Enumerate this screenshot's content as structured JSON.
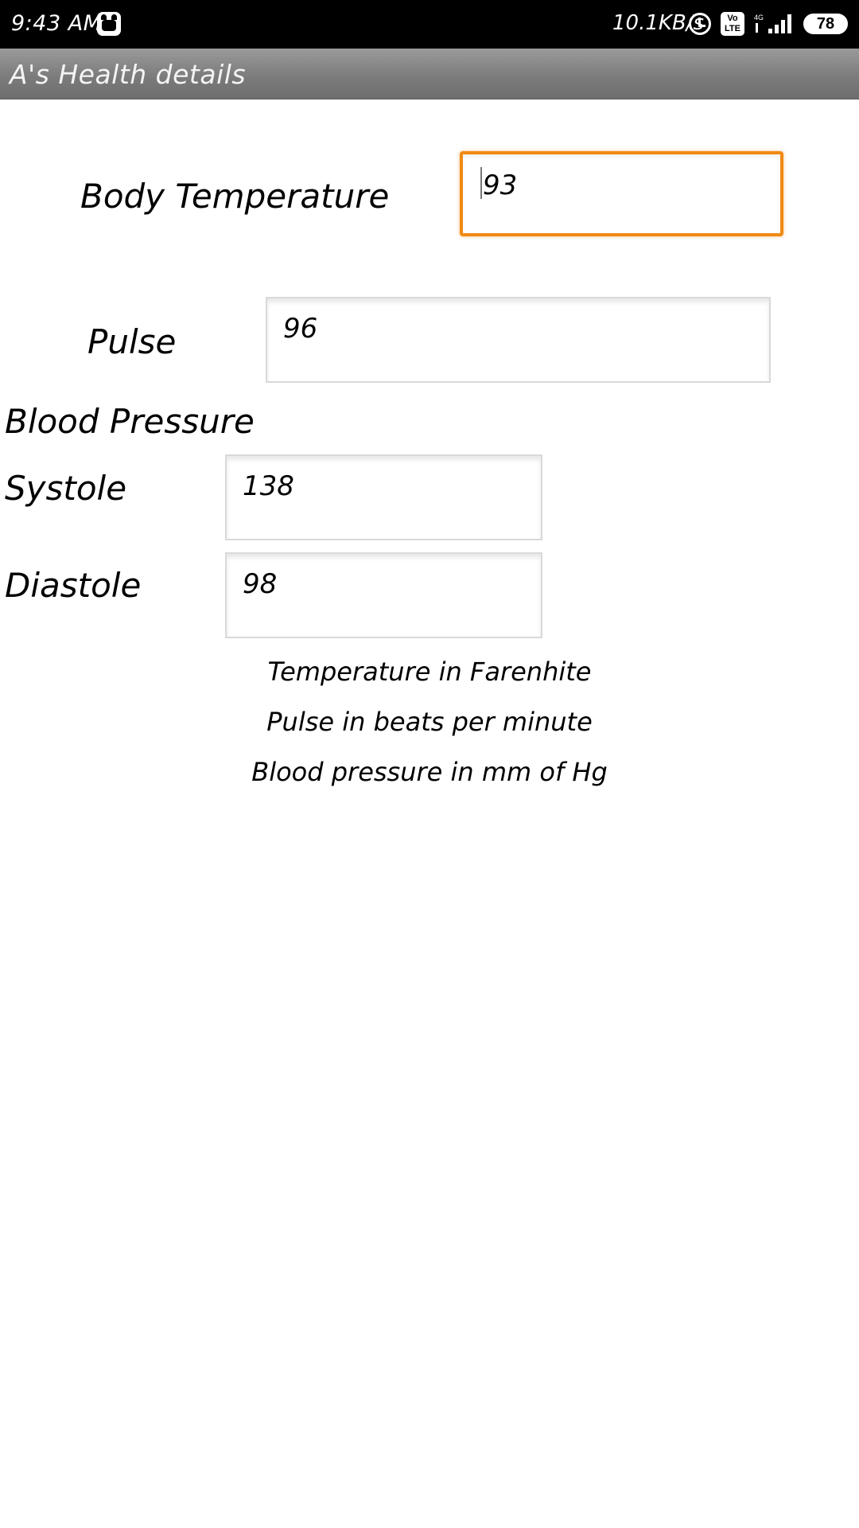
{
  "status_bar": {
    "time": "9:43 AM",
    "net_speed": "10.1KB/s",
    "volte_top": "Vo",
    "volte_bottom": "LTE",
    "network_type": "4G",
    "battery": "78",
    "icons": [
      "app-notification-icon",
      "alarm-icon",
      "volte-icon",
      "signal-icon",
      "battery-icon"
    ]
  },
  "action_bar": {
    "title": "A's Health details"
  },
  "form": {
    "body_temperature": {
      "label": "Body Temperature",
      "value": "93"
    },
    "pulse": {
      "label": "Pulse",
      "value": "96"
    },
    "blood_pressure": {
      "heading": "Blood Pressure",
      "systole": {
        "label": "Systole",
        "value": "138"
      },
      "diastole": {
        "label": "Diastole",
        "value": "98"
      }
    }
  },
  "notes": [
    "Temperature in Farenhite",
    "Pulse in beats per minute",
    "Blood pressure in mm of Hg"
  ],
  "colors": {
    "status_bar_bg": "#000000",
    "action_bar_bg": "#808080",
    "focus_accent": "#f08a13",
    "field_border": "#d9d9d9"
  }
}
